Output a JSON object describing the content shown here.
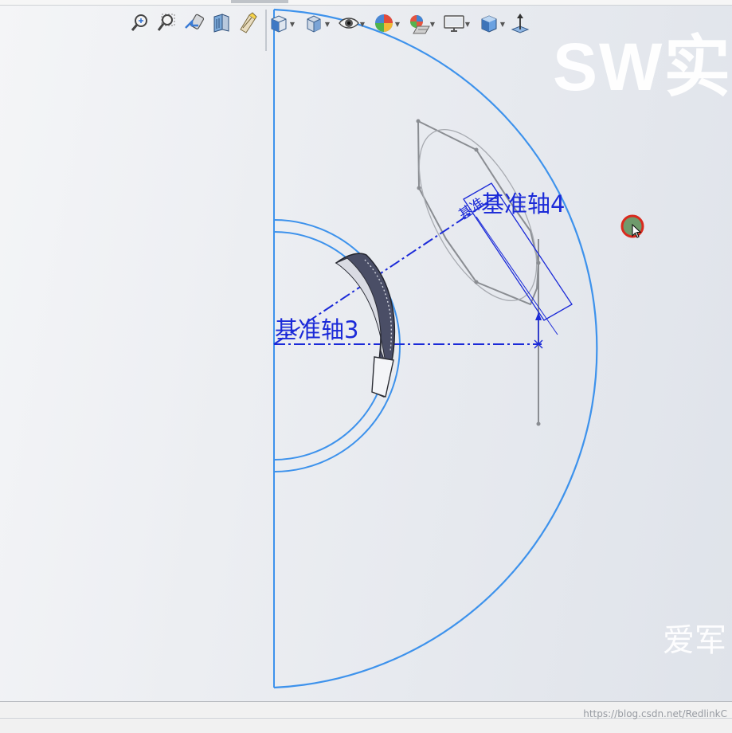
{
  "toolbar": {
    "items": [
      {
        "name": "zoom-to-fit-icon"
      },
      {
        "name": "zoom-to-area-icon"
      },
      {
        "name": "previous-view-icon"
      },
      {
        "name": "section-view-icon"
      },
      {
        "name": "dynamic-annotation-icon"
      },
      {
        "name": "view-orientation-icon"
      },
      {
        "name": "display-style-icon"
      },
      {
        "name": "hide-show-items-icon"
      },
      {
        "name": "edit-appearance-icon"
      },
      {
        "name": "apply-scene-icon"
      },
      {
        "name": "view-settings-icon"
      },
      {
        "name": "rotate-view-icon"
      },
      {
        "name": "normal-to-icon"
      }
    ]
  },
  "scene": {
    "axis3_label": "基准轴3",
    "axis4_label": "基准轴4",
    "plane_tag_label": "基准",
    "sketch_color": "#3d92ec",
    "axis_color": "#1b2ad8",
    "construction_color": "#8a8d92"
  },
  "watermarks": {
    "brand": "SW实",
    "corner": "爱军",
    "source_url": "https://blog.csdn.net/RedlinkC"
  }
}
